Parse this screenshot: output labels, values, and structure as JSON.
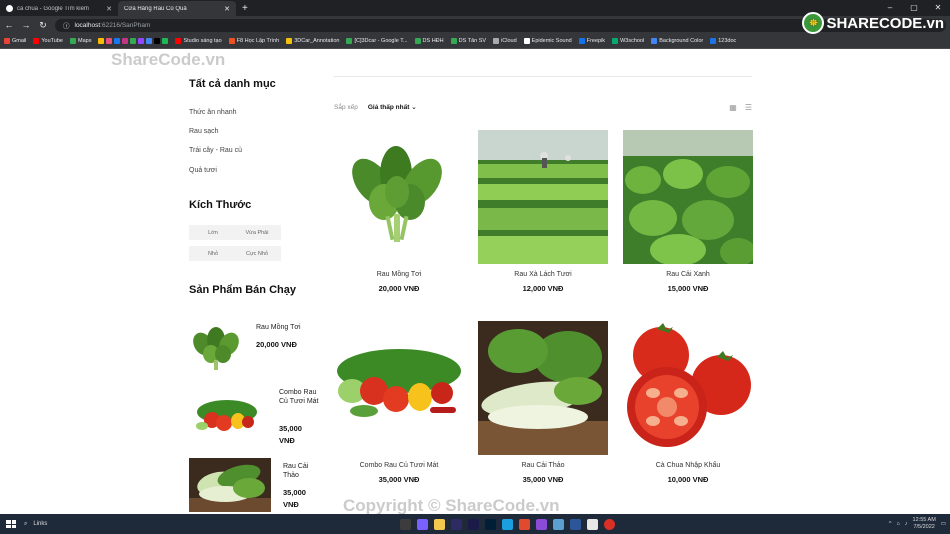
{
  "browser": {
    "tabs": [
      {
        "title": "cà chua - Google Tìm kiếm",
        "active": false
      },
      {
        "title": "Cửa Hàng Rau Củ Quả",
        "active": true
      }
    ],
    "url_host": "localhost",
    "url_path": ":62216/SanPham",
    "bookmarks": [
      "Gmail",
      "YouTube",
      "Maps",
      "Studio sáng tạo",
      "F8 Học Lập Trình",
      "3DCar_Annotation",
      "[C]3Dcar - Google T...",
      "DS HĐH",
      "DS Tân SV",
      "iCloud",
      "Epidemic Sound",
      "Freepik",
      "W3school",
      "Background Color",
      "123doc"
    ]
  },
  "watermarks": {
    "top": "ShareCode.vn",
    "bottom": "Copyright © ShareCode.vn",
    "logo": "SHARECODE.vn"
  },
  "sidebar": {
    "categories_title": "Tất cả danh mục",
    "categories": [
      "Thức ăn nhanh",
      "Rau sạch",
      "Trái cây - Rau củ",
      "Quả tươi"
    ],
    "size_title": "Kích Thước",
    "sizes": [
      "Lớn",
      "Vừa Phải",
      "Nhỏ",
      "Cực Nhỏ"
    ],
    "bestseller_title": "Sản Phẩm Bán Chạy",
    "bestsellers": [
      {
        "name": "Rau Mồng Tơi",
        "price": "20,000 VNĐ"
      },
      {
        "name": "Combo Rau Củ Tươi Mát",
        "price": "35,000 VNĐ"
      },
      {
        "name": "Rau Cải Thảo",
        "price": "35,000 VNĐ"
      }
    ]
  },
  "sort": {
    "label": "Sắp xếp",
    "value": "Giá thấp nhất"
  },
  "products": [
    {
      "name": "Rau Mồng Tơi",
      "price": "20,000 VNĐ"
    },
    {
      "name": "Rau Xà Lách Tươi",
      "price": "12,000 VNĐ"
    },
    {
      "name": "Rau Cải Xanh",
      "price": "15,000 VNĐ"
    },
    {
      "name": "Combo Rau Củ Tươi Mát",
      "price": "35,000 VNĐ"
    },
    {
      "name": "Rau Cải Thảo",
      "price": "35,000 VNĐ"
    },
    {
      "name": "Cà Chua Nhập Khẩu",
      "price": "10,000 VNĐ"
    }
  ],
  "taskbar": {
    "search": "Links",
    "time": "12:55 AM",
    "date": "7/5/2022"
  }
}
